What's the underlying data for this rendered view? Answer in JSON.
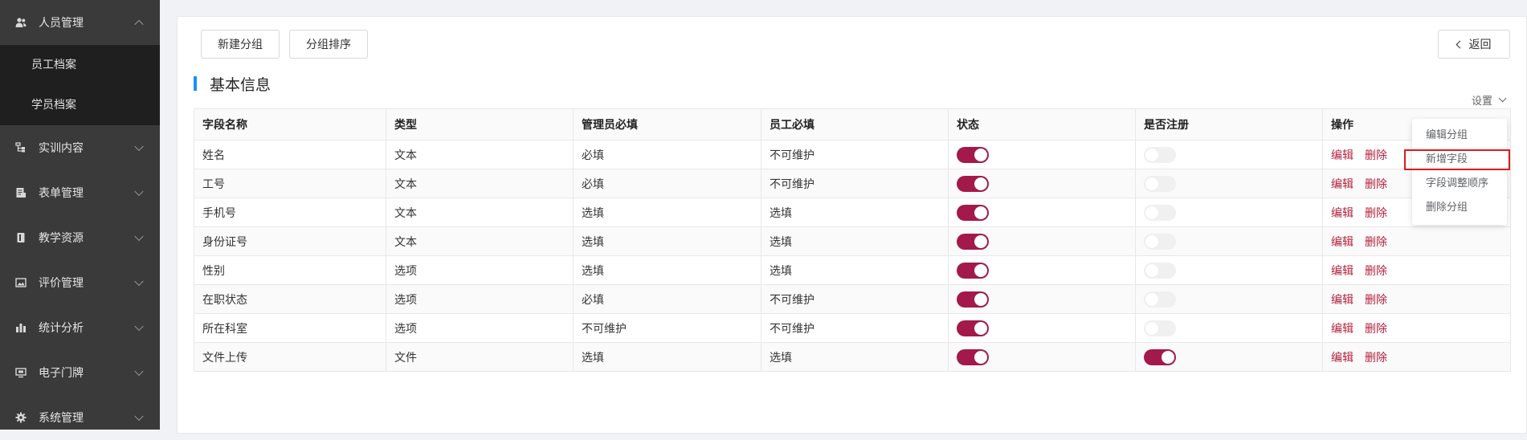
{
  "sidebar": {
    "groups": [
      {
        "label": "人员管理",
        "icon": "users-icon",
        "expanded": true,
        "children": [
          "员工档案",
          "学员档案"
        ]
      },
      {
        "label": "实训内容",
        "icon": "tree-icon"
      },
      {
        "label": "表单管理",
        "icon": "form-icon"
      },
      {
        "label": "教学资源",
        "icon": "book-icon"
      },
      {
        "label": "评价管理",
        "icon": "image-icon"
      },
      {
        "label": "统计分析",
        "icon": "bar-chart-icon"
      },
      {
        "label": "电子门牌",
        "icon": "monitor-icon"
      },
      {
        "label": "系统管理",
        "icon": "gear-icon"
      }
    ]
  },
  "toolbar": {
    "new_group": "新建分组",
    "sort_group": "分组排序",
    "back": "返回"
  },
  "section": {
    "title": "基本信息",
    "settings": "设置"
  },
  "table": {
    "columns": [
      "字段名称",
      "类型",
      "管理员必填",
      "员工必填",
      "状态",
      "是否注册",
      "操作"
    ],
    "rows": [
      {
        "name": "姓名",
        "type": "文本",
        "admin": "必填",
        "staff": "不可维护",
        "status": true,
        "register": false
      },
      {
        "name": "工号",
        "type": "文本",
        "admin": "必填",
        "staff": "不可维护",
        "status": true,
        "register": false
      },
      {
        "name": "手机号",
        "type": "文本",
        "admin": "选填",
        "staff": "选填",
        "status": true,
        "register": false
      },
      {
        "name": "身份证号",
        "type": "文本",
        "admin": "选填",
        "staff": "选填",
        "status": true,
        "register": false
      },
      {
        "name": "性别",
        "type": "选项",
        "admin": "选填",
        "staff": "选填",
        "status": true,
        "register": false
      },
      {
        "name": "在职状态",
        "type": "选项",
        "admin": "必填",
        "staff": "不可维护",
        "status": true,
        "register": false
      },
      {
        "name": "所在科室",
        "type": "选项",
        "admin": "不可维护",
        "staff": "不可维护",
        "status": true,
        "register": false
      },
      {
        "name": "文件上传",
        "type": "文件",
        "admin": "选填",
        "staff": "选填",
        "status": true,
        "register": true
      }
    ],
    "edit_label": "编辑",
    "delete_label": "删除"
  },
  "dropdown": {
    "items": [
      "编辑分组",
      "新增字段",
      "字段调整顺序",
      "删除分组"
    ],
    "highlighted_index": 1
  },
  "colors": {
    "accent": "#1890ff",
    "switch_on": "#a3194a",
    "link": "#b3213f",
    "sidebar_bg": "#3a3a3a",
    "submenu_bg": "#1f1f1f",
    "highlight_border": "#e0191b"
  }
}
